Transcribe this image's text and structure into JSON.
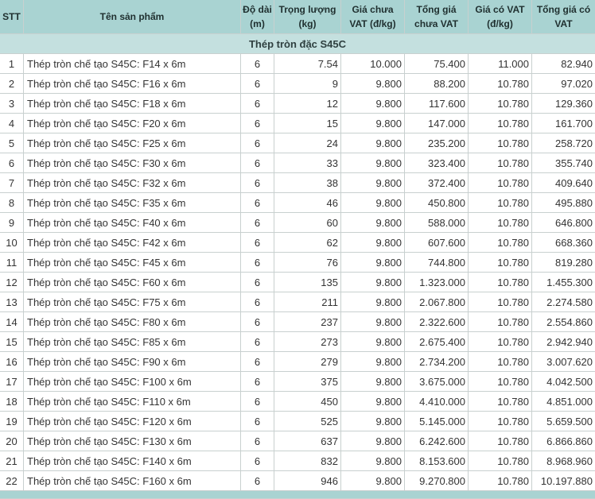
{
  "headers": {
    "stt": "STT",
    "name": "Tên sản phẩm",
    "length": [
      "Độ dài",
      "(m)"
    ],
    "weight": [
      "Trọng lượng",
      "(kg)"
    ],
    "price_ex_vat": [
      "Giá chưa",
      "VAT (đ/kg)"
    ],
    "total_ex_vat": [
      "Tổng giá",
      "chưa VAT"
    ],
    "price_inc_vat": [
      "Giá có VAT",
      "(đ/kg)"
    ],
    "total_inc_vat": [
      "Tổng giá có",
      "VAT"
    ]
  },
  "group_title": "Thép tròn đặc S45C",
  "rows": [
    {
      "stt": "1",
      "name": "Thép tròn chế tạo S45C: F14 x 6m",
      "length": "6",
      "weight": "7.54",
      "price": "10.000",
      "total": "75.400",
      "price_vat": "11.000",
      "total_vat": "82.940"
    },
    {
      "stt": "2",
      "name": "Thép tròn chế tạo S45C: F16 x 6m",
      "length": "6",
      "weight": "9",
      "price": "9.800",
      "total": "88.200",
      "price_vat": "10.780",
      "total_vat": "97.020"
    },
    {
      "stt": "3",
      "name": "Thép tròn chế tạo S45C: F18 x 6m",
      "length": "6",
      "weight": "12",
      "price": "9.800",
      "total": "117.600",
      "price_vat": "10.780",
      "total_vat": "129.360"
    },
    {
      "stt": "4",
      "name": "Thép tròn chế tạo S45C: F20 x 6m",
      "length": "6",
      "weight": "15",
      "price": "9.800",
      "total": "147.000",
      "price_vat": "10.780",
      "total_vat": "161.700"
    },
    {
      "stt": "5",
      "name": "Thép tròn chế tạo S45C: F25 x 6m",
      "length": "6",
      "weight": "24",
      "price": "9.800",
      "total": "235.200",
      "price_vat": "10.780",
      "total_vat": "258.720"
    },
    {
      "stt": "6",
      "name": "Thép tròn chế tạo S45C: F30 x 6m",
      "length": "6",
      "weight": "33",
      "price": "9.800",
      "total": "323.400",
      "price_vat": "10.780",
      "total_vat": "355.740"
    },
    {
      "stt": "7",
      "name": "Thép tròn chế tạo S45C: F32 x 6m",
      "length": "6",
      "weight": "38",
      "price": "9.800",
      "total": "372.400",
      "price_vat": "10.780",
      "total_vat": "409.640"
    },
    {
      "stt": "8",
      "name": "Thép tròn chế tạo S45C: F35 x 6m",
      "length": "6",
      "weight": "46",
      "price": "9.800",
      "total": "450.800",
      "price_vat": "10.780",
      "total_vat": "495.880"
    },
    {
      "stt": "9",
      "name": "Thép tròn chế tạo S45C: F40 x 6m",
      "length": "6",
      "weight": "60",
      "price": "9.800",
      "total": "588.000",
      "price_vat": "10.780",
      "total_vat": "646.800"
    },
    {
      "stt": "10",
      "name": "Thép tròn chế tạo S45C: F42 x 6m",
      "length": "6",
      "weight": "62",
      "price": "9.800",
      "total": "607.600",
      "price_vat": "10.780",
      "total_vat": "668.360"
    },
    {
      "stt": "11",
      "name": "Thép tròn chế tạo S45C: F45 x 6m",
      "length": "6",
      "weight": "76",
      "price": "9.800",
      "total": "744.800",
      "price_vat": "10.780",
      "total_vat": "819.280"
    },
    {
      "stt": "12",
      "name": "Thép tròn chế tạo S45C: F60 x 6m",
      "length": "6",
      "weight": "135",
      "price": "9.800",
      "total": "1.323.000",
      "price_vat": "10.780",
      "total_vat": "1.455.300"
    },
    {
      "stt": "13",
      "name": "Thép tròn chế tạo S45C: F75 x 6m",
      "length": "6",
      "weight": "211",
      "price": "9.800",
      "total": "2.067.800",
      "price_vat": "10.780",
      "total_vat": "2.274.580"
    },
    {
      "stt": "14",
      "name": "Thép tròn chế tạo S45C: F80 x 6m",
      "length": "6",
      "weight": "237",
      "price": "9.800",
      "total": "2.322.600",
      "price_vat": "10.780",
      "total_vat": "2.554.860"
    },
    {
      "stt": "15",
      "name": "Thép tròn chế tạo S45C: F85 x 6m",
      "length": "6",
      "weight": "273",
      "price": "9.800",
      "total": "2.675.400",
      "price_vat": "10.780",
      "total_vat": "2.942.940"
    },
    {
      "stt": "16",
      "name": "Thép tròn chế tạo S45C: F90 x 6m",
      "length": "6",
      "weight": "279",
      "price": "9.800",
      "total": "2.734.200",
      "price_vat": "10.780",
      "total_vat": "3.007.620"
    },
    {
      "stt": "17",
      "name": "Thép tròn chế tạo S45C: F100 x 6m",
      "length": "6",
      "weight": "375",
      "price": "9.800",
      "total": "3.675.000",
      "price_vat": "10.780",
      "total_vat": "4.042.500"
    },
    {
      "stt": "18",
      "name": "Thép tròn chế tạo S45C: F110 x 6m",
      "length": "6",
      "weight": "450",
      "price": "9.800",
      "total": "4.410.000",
      "price_vat": "10.780",
      "total_vat": "4.851.000"
    },
    {
      "stt": "19",
      "name": "Thép tròn chế tạo S45C: F120 x 6m",
      "length": "6",
      "weight": "525",
      "price": "9.800",
      "total": "5.145.000",
      "price_vat": "10.780",
      "total_vat": "5.659.500"
    },
    {
      "stt": "20",
      "name": "Thép tròn chế tạo S45C: F130 x 6m",
      "length": "6",
      "weight": "637",
      "price": "9.800",
      "total": "6.242.600",
      "price_vat": "10.780",
      "total_vat": "6.866.860"
    },
    {
      "stt": "21",
      "name": "Thép tròn chế tạo S45C: F140 x 6m",
      "length": "6",
      "weight": "832",
      "price": "9.800",
      "total": "8.153.600",
      "price_vat": "10.780",
      "total_vat": "8.968.960"
    },
    {
      "stt": "22",
      "name": "Thép tròn chế tạo S45C: F160 x 6m",
      "length": "6",
      "weight": "946",
      "price": "9.800",
      "total": "9.270.800",
      "price_vat": "10.780",
      "total_vat": "10.197.880"
    }
  ]
}
